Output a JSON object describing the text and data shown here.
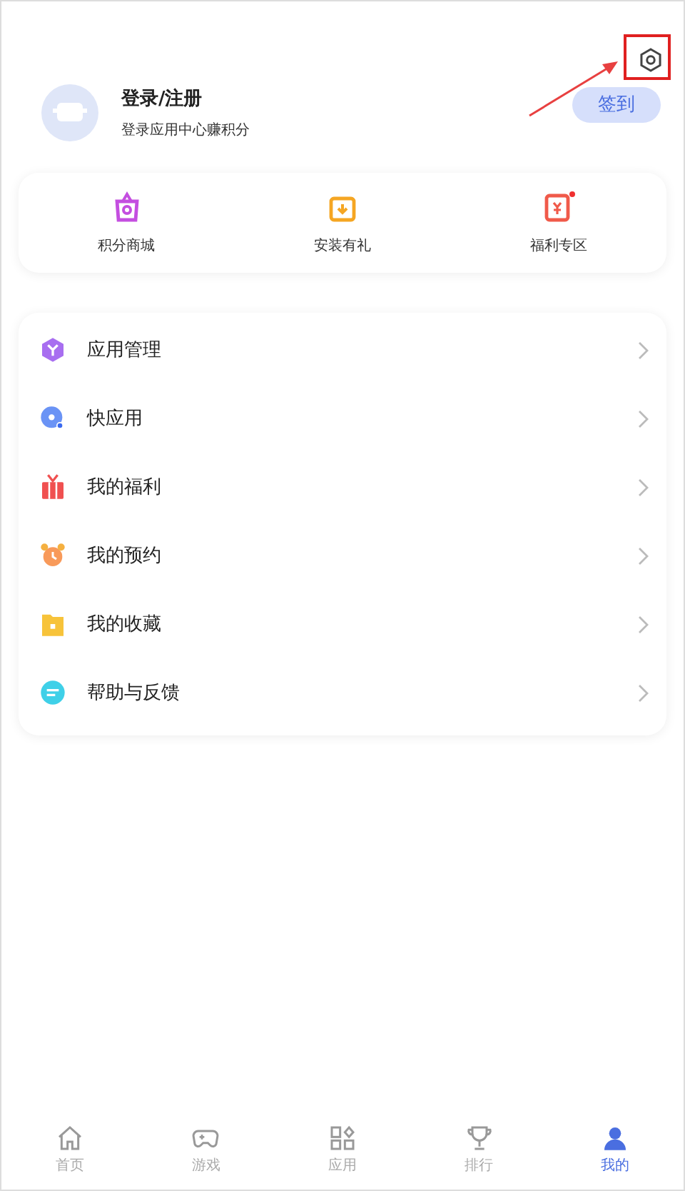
{
  "profile": {
    "title": "登录/注册",
    "subtitle": "登录应用中心赚积分",
    "checkin": "签到"
  },
  "shortcuts": [
    {
      "kind": "shop",
      "label": "积分商城",
      "color": "#c44ee0",
      "badge": false
    },
    {
      "kind": "install",
      "label": "安装有礼",
      "color": "#f5a623",
      "badge": false
    },
    {
      "kind": "welfare",
      "label": "福利专区",
      "color": "#f05a4a",
      "badge": true
    }
  ],
  "menu": [
    {
      "kind": "cube",
      "label": "应用管理"
    },
    {
      "kind": "quick",
      "label": "快应用"
    },
    {
      "kind": "gift",
      "label": "我的福利"
    },
    {
      "kind": "alarm",
      "label": "我的预约"
    },
    {
      "kind": "folder",
      "label": "我的收藏"
    },
    {
      "kind": "chat",
      "label": "帮助与反馈"
    }
  ],
  "nav": [
    {
      "kind": "home",
      "label": "首页",
      "selected": false
    },
    {
      "kind": "game",
      "label": "游戏",
      "selected": false
    },
    {
      "kind": "apps",
      "label": "应用",
      "selected": false
    },
    {
      "kind": "trophy",
      "label": "排行",
      "selected": false
    },
    {
      "kind": "me",
      "label": "我的",
      "selected": true
    }
  ]
}
